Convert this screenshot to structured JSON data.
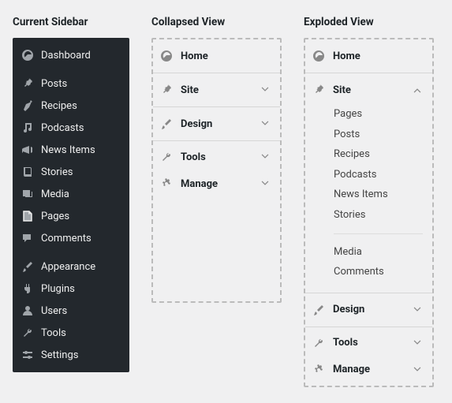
{
  "titles": {
    "current": "Current Sidebar",
    "collapsed": "Collapsed View",
    "exploded": "Exploded View"
  },
  "current_sidebar": {
    "items_a": [
      {
        "icon": "dashboard",
        "label": "Dashboard"
      }
    ],
    "items_b": [
      {
        "icon": "pin",
        "label": "Posts"
      },
      {
        "icon": "carrot",
        "label": "Recipes"
      },
      {
        "icon": "music",
        "label": "Podcasts"
      },
      {
        "icon": "megaphone",
        "label": "News Items"
      },
      {
        "icon": "book",
        "label": "Stories"
      },
      {
        "icon": "media",
        "label": "Media"
      },
      {
        "icon": "page",
        "label": "Pages"
      },
      {
        "icon": "comments",
        "label": "Comments"
      }
    ],
    "items_c": [
      {
        "icon": "brush",
        "label": "Appearance"
      },
      {
        "icon": "plug",
        "label": "Plugins"
      },
      {
        "icon": "user",
        "label": "Users"
      },
      {
        "icon": "wrench",
        "label": "Tools"
      },
      {
        "icon": "sliders",
        "label": "Settings"
      }
    ]
  },
  "collapsed_view": {
    "groups": [
      {
        "items": [
          {
            "icon": "dashboard",
            "label": "Home",
            "chevron": false
          }
        ]
      },
      {
        "items": [
          {
            "icon": "pin",
            "label": "Site",
            "chevron": "down"
          }
        ]
      },
      {
        "items": [
          {
            "icon": "brush",
            "label": "Design",
            "chevron": "down"
          }
        ]
      },
      {
        "items": [
          {
            "icon": "wrench",
            "label": "Tools",
            "chevron": "down"
          },
          {
            "icon": "gear",
            "label": "Manage",
            "chevron": "down"
          }
        ]
      }
    ]
  },
  "exploded_view": {
    "home": {
      "icon": "dashboard",
      "label": "Home"
    },
    "site": {
      "icon": "pin",
      "label": "Site",
      "expanded": true,
      "children_a": [
        "Pages",
        "Posts",
        "Recipes",
        "Podcasts",
        "News Items",
        "Stories"
      ],
      "children_b": [
        "Media",
        "Comments"
      ]
    },
    "design": {
      "icon": "brush",
      "label": "Design",
      "chevron": "down"
    },
    "tools_group": [
      {
        "icon": "wrench",
        "label": "Tools",
        "chevron": "down"
      },
      {
        "icon": "gear",
        "label": "Manage",
        "chevron": "down"
      }
    ]
  }
}
